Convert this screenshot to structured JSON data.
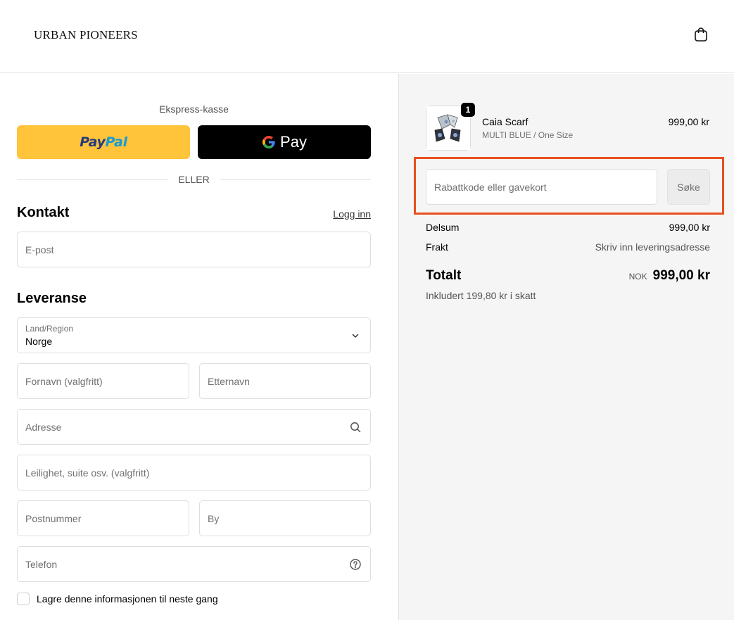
{
  "header": {
    "brand": "URBAN PIONEERS"
  },
  "express": {
    "title": "Ekspress-kasse",
    "paypal_part1": "Pay",
    "paypal_part2": "Pal",
    "gpay_label": "Pay",
    "or_text": "ELLER"
  },
  "contact": {
    "title": "Kontakt",
    "login_link": "Logg inn",
    "email_placeholder": "E-post"
  },
  "delivery": {
    "title": "Leveranse",
    "country_label": "Land/Region",
    "country_value": "Norge",
    "first_name_placeholder": "Fornavn (valgfritt)",
    "last_name_placeholder": "Etternavn",
    "address_placeholder": "Adresse",
    "apartment_placeholder": "Leilighet, suite osv. (valgfritt)",
    "postcode_placeholder": "Postnummer",
    "city_placeholder": "By",
    "phone_placeholder": "Telefon",
    "save_info_label": "Lagre denne informasjonen til neste gang"
  },
  "order": {
    "item": {
      "quantity": "1",
      "name": "Caia Scarf",
      "variant": "MULTI BLUE / One Size",
      "price": "999,00 kr"
    },
    "discount_placeholder": "Rabattkode eller gavekort",
    "apply_label": "Søke",
    "subtotal_label": "Delsum",
    "subtotal_value": "999,00 kr",
    "shipping_label": "Frakt",
    "shipping_value": "Skriv inn leveringsadresse",
    "total_label": "Totalt",
    "total_currency": "NOK",
    "total_value": "999,00 kr",
    "tax_note": "Inkludert 199,80 kr i skatt"
  },
  "colors": {
    "highlight": "#e8501e",
    "paypal_yellow": "#ffc439",
    "summary_bg": "#f5f5f5"
  }
}
